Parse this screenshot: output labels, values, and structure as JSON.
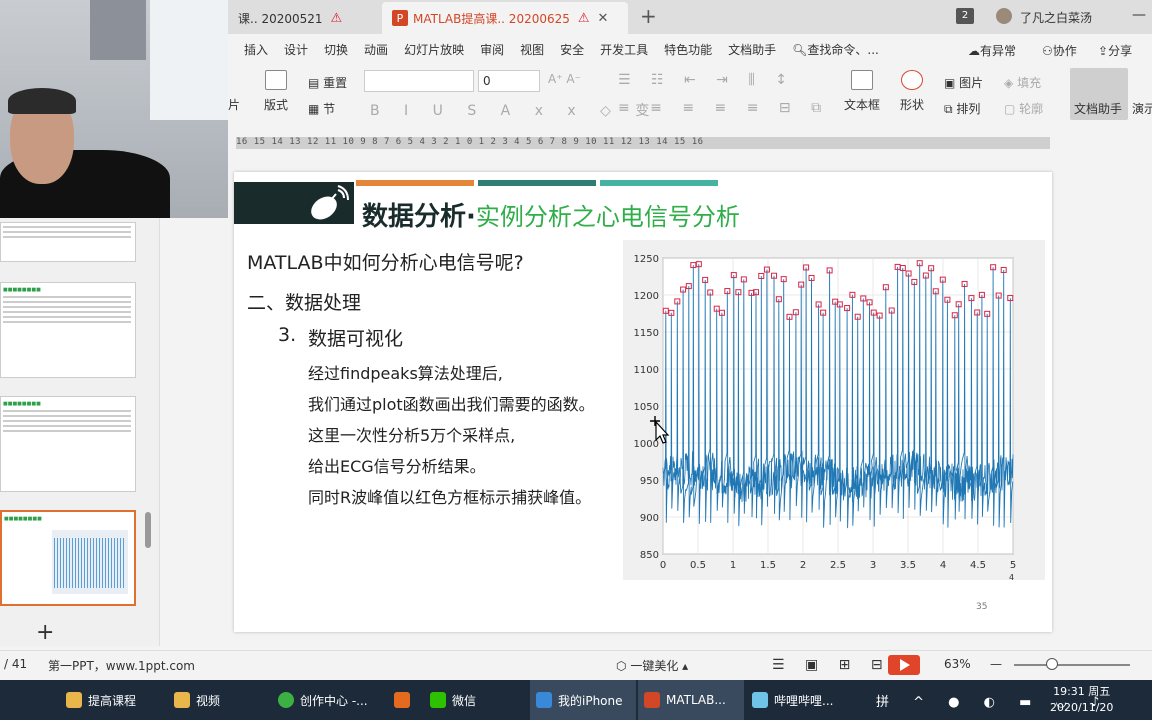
{
  "tabs": [
    {
      "label": "课.. 20200521"
    },
    {
      "label": "MATLAB提高课.. 20200625"
    }
  ],
  "window": {
    "badge": "2",
    "user": "了凡之白菜汤"
  },
  "menu": {
    "items": [
      "插入",
      "设计",
      "切换",
      "动画",
      "幻灯片放映",
      "审阅",
      "视图",
      "安全",
      "开发工具",
      "特色功能",
      "文档助手"
    ],
    "search": "查找命令、...",
    "anomaly": "有异常",
    "collab": "协作",
    "share": "分享"
  },
  "ribbon": {
    "img_label": "片",
    "layout_label": "版式",
    "reset_label": "重置",
    "section_label": "节",
    "font_size": "0",
    "textbox_label": "文本框",
    "shape_label": "形状",
    "picture_label": "图片",
    "fill_label": "填充",
    "arrange_label": "排列",
    "outline_label": "轮廓",
    "doc_assist_label": "文档助手",
    "present_label": "演示"
  },
  "ruler_text": "16 15 14 13 12 11 10 9 8 7 6 5 4 3 2 1 0 1 2 3 4 5 6 7 8 9 10 11 12 13 14 15 16",
  "slide": {
    "title_main": "数据分析·",
    "title_sub": "实例分析之心电信号分析",
    "question": "MATLAB中如何分析心电信号呢?",
    "section": "二、数据处理",
    "subsection_num": "3.",
    "subsection": "数据可视化",
    "body": [
      "经过findpeaks算法处理后,",
      "我们通过plot函数画出我们需要的函数。",
      "这里一次性分析5万个采样点,",
      "给出ECG信号分析结果。",
      "同时R波峰值以红色方框标示捕获峰值。"
    ],
    "page_number": "35"
  },
  "colors": {
    "green": "#2fae49",
    "dark": "#1a2b2b",
    "orange": "#e3863a",
    "teal": "#2f7d74",
    "teal2": "#44b3a1",
    "signal": "#1f77b4",
    "peak": "#d62748"
  },
  "chart_data": {
    "type": "line",
    "x_range": [
      0,
      5
    ],
    "xlim": [
      0,
      5
    ],
    "ylim": [
      850,
      1250
    ],
    "x_ticks": [
      "0",
      "0.5",
      "1",
      "1.5",
      "2",
      "2.5",
      "3",
      "3.5",
      "4",
      "4.5",
      "5"
    ],
    "y_ticks": [
      "850",
      "900",
      "950",
      "1000",
      "1050",
      "1100",
      "1150",
      "1200",
      "1250"
    ],
    "x_exponent": "4",
    "grid": true,
    "series": [
      {
        "kind": "signal",
        "baseline": 955,
        "baseline_range": [
          930,
          985
        ],
        "trough_min": 885
      },
      {
        "kind": "peaks",
        "marker": "square",
        "typical_range": [
          1170,
          1245
        ],
        "mean": 1200
      }
    ]
  },
  "status": {
    "page": "/ 41",
    "theme": "第一PPT，www.1ppt.com",
    "beautify": "一键美化",
    "zoom": "63%"
  },
  "taskbar": {
    "items": [
      "提高课程",
      "视频",
      "创作中心 -...",
      "微信",
      "我的iPhone",
      "MATLAB...",
      "哔哩哔哩..."
    ],
    "time": "19:31 周五",
    "date": "2020/11/20"
  }
}
